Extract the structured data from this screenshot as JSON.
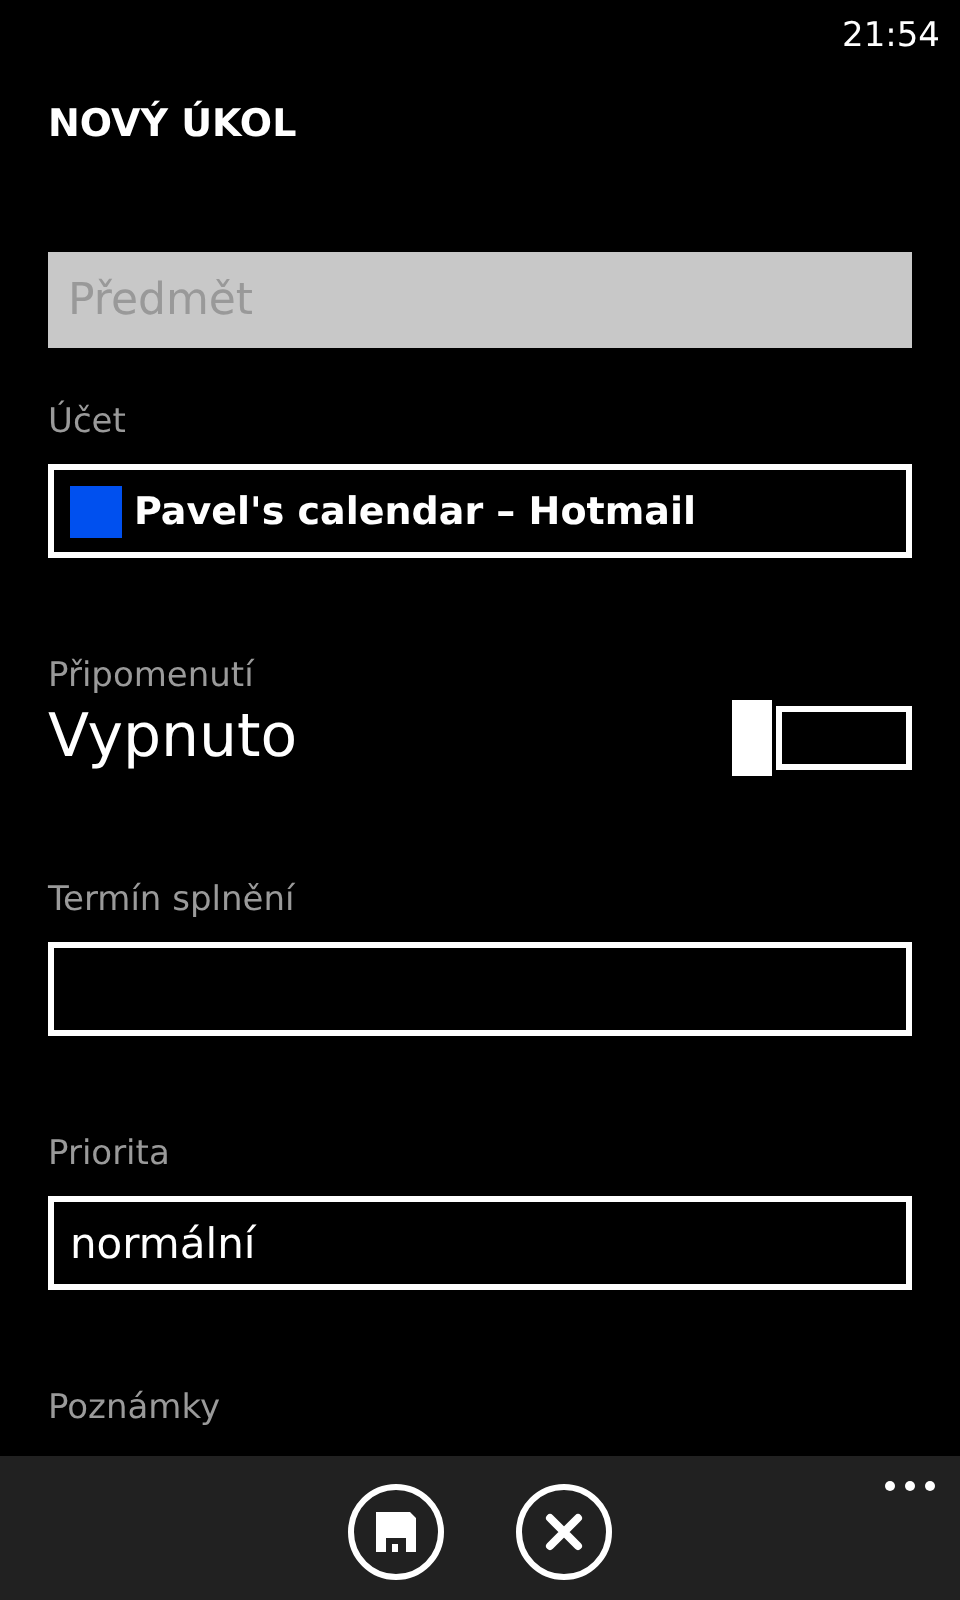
{
  "status_bar": {
    "time": "21:54"
  },
  "title": "NOVÝ ÚKOL",
  "subject": {
    "placeholder": "Předmět"
  },
  "account": {
    "label": "Účet",
    "value": "Pavel's calendar – Hotmail",
    "color": "#0050ef"
  },
  "reminder": {
    "label": "Připomenutí",
    "value": "Vypnuto",
    "on": false
  },
  "due_date": {
    "label": "Termín splnění"
  },
  "priority": {
    "label": "Priorita",
    "value": "normální"
  },
  "notes": {
    "label": "Poznámky"
  }
}
